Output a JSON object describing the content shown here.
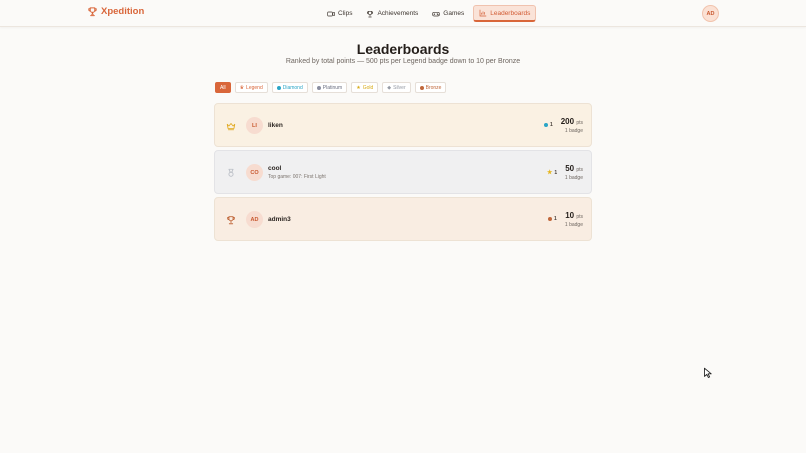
{
  "brand": {
    "name": "Xpedition"
  },
  "nav": [
    {
      "label": "Clips",
      "icon": "video-icon"
    },
    {
      "label": "Achievements",
      "icon": "trophy-icon"
    },
    {
      "label": "Games",
      "icon": "gamepad-icon"
    },
    {
      "label": "Leaderboards",
      "icon": "chart-icon",
      "active": true
    }
  ],
  "user": {
    "initials": "AD"
  },
  "page": {
    "title": "Leaderboards",
    "subtitle": "Ranked by total points — 500 pts per Legend badge down to 10 per Bronze"
  },
  "filters": [
    {
      "label": "All",
      "color": "#d9663a",
      "active": true
    },
    {
      "label": "Legend",
      "color": "#d9663a"
    },
    {
      "label": "Diamond",
      "color": "#2aa5c6"
    },
    {
      "label": "Platinum",
      "color": "#8a8ea0"
    },
    {
      "label": "Gold",
      "color": "#e5b51c"
    },
    {
      "label": "Silver",
      "color": "#a6abb4"
    },
    {
      "label": "Bronze",
      "color": "#c0673a"
    }
  ],
  "rows": [
    {
      "initials": "LI",
      "name": "liken",
      "subtitle": "",
      "badge_count": "1",
      "badge_color": "#2aa5c6",
      "points": "200",
      "points_unit": "pts",
      "badges_label": "1 badge",
      "rank_icon": "crown-icon"
    },
    {
      "initials": "CO",
      "name": "cool",
      "subtitle": "Top game: 007: First Light",
      "badge_count": "1",
      "badge_color": "#e5b51c",
      "points": "50",
      "points_unit": "pts",
      "badges_label": "1 badge",
      "rank_icon": "medal-icon"
    },
    {
      "initials": "AD",
      "name": "admin3",
      "subtitle": "",
      "badge_count": "1",
      "badge_color": "#c0673a",
      "points": "10",
      "points_unit": "pts",
      "badges_label": "1 badge",
      "rank_icon": "trophy-icon"
    }
  ]
}
